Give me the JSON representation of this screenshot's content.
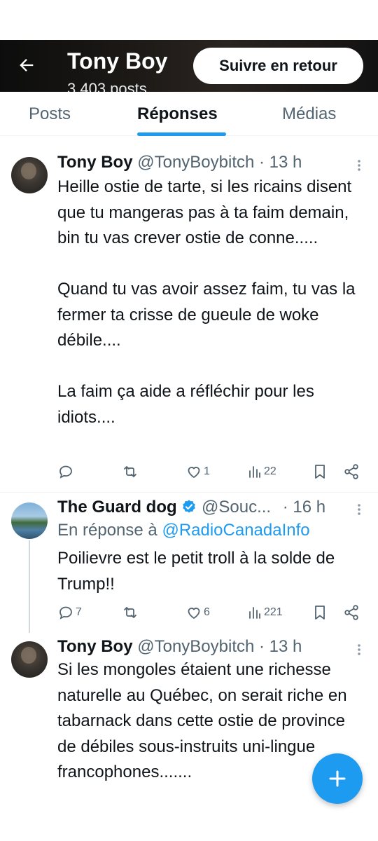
{
  "header": {
    "title": "Tony Boy",
    "subtitle": "3 403 posts",
    "follow_label": "Suivre en retour"
  },
  "tabs": [
    {
      "label": "Posts"
    },
    {
      "label": "Réponses"
    },
    {
      "label": "Médias"
    }
  ],
  "tweets": [
    {
      "name": "Tony Boy",
      "handle": "@TonyBoybitch",
      "time": "· 13 h",
      "text": "Heille ostie de tarte, si les ricains disent que tu mangeras pas à ta faim demain, bin tu vas crever ostie de conne.....\n\nQuand tu vas avoir assez faim, tu vas la fermer ta crisse de gueule de woke débile....\n\nLa faim ça aide a réfléchir pour les idiots....",
      "replies": "",
      "reposts": "",
      "likes": "1",
      "views": "22"
    },
    {
      "name": "The Guard dog",
      "handle": "@Souc...",
      "time": "· 16 h",
      "reply_prefix": "En réponse à",
      "reply_handle": "@RadioCanadaInfo",
      "text": "Poilievre est le petit troll à la solde de Trump!!",
      "replies": "7",
      "reposts": "",
      "likes": "6",
      "views": "221"
    },
    {
      "name": "Tony Boy",
      "handle": "@TonyBoybitch",
      "time": "· 13 h",
      "text": "Si les mongoles étaient une richesse naturelle au Québec, on serait riche en tabarnack dans cette ostie de province de débiles sous-instruits uni-lingue francophones......."
    }
  ],
  "colors": {
    "accent": "#1d9bf0",
    "text": "#0f1419",
    "muted": "#536471",
    "verified": "#1d9bf0"
  },
  "icons": [
    "back-arrow-icon",
    "more-icon",
    "reply-icon",
    "repost-icon",
    "like-icon",
    "views-icon",
    "bookmark-icon",
    "share-icon",
    "verified-badge-icon",
    "plus-icon"
  ]
}
